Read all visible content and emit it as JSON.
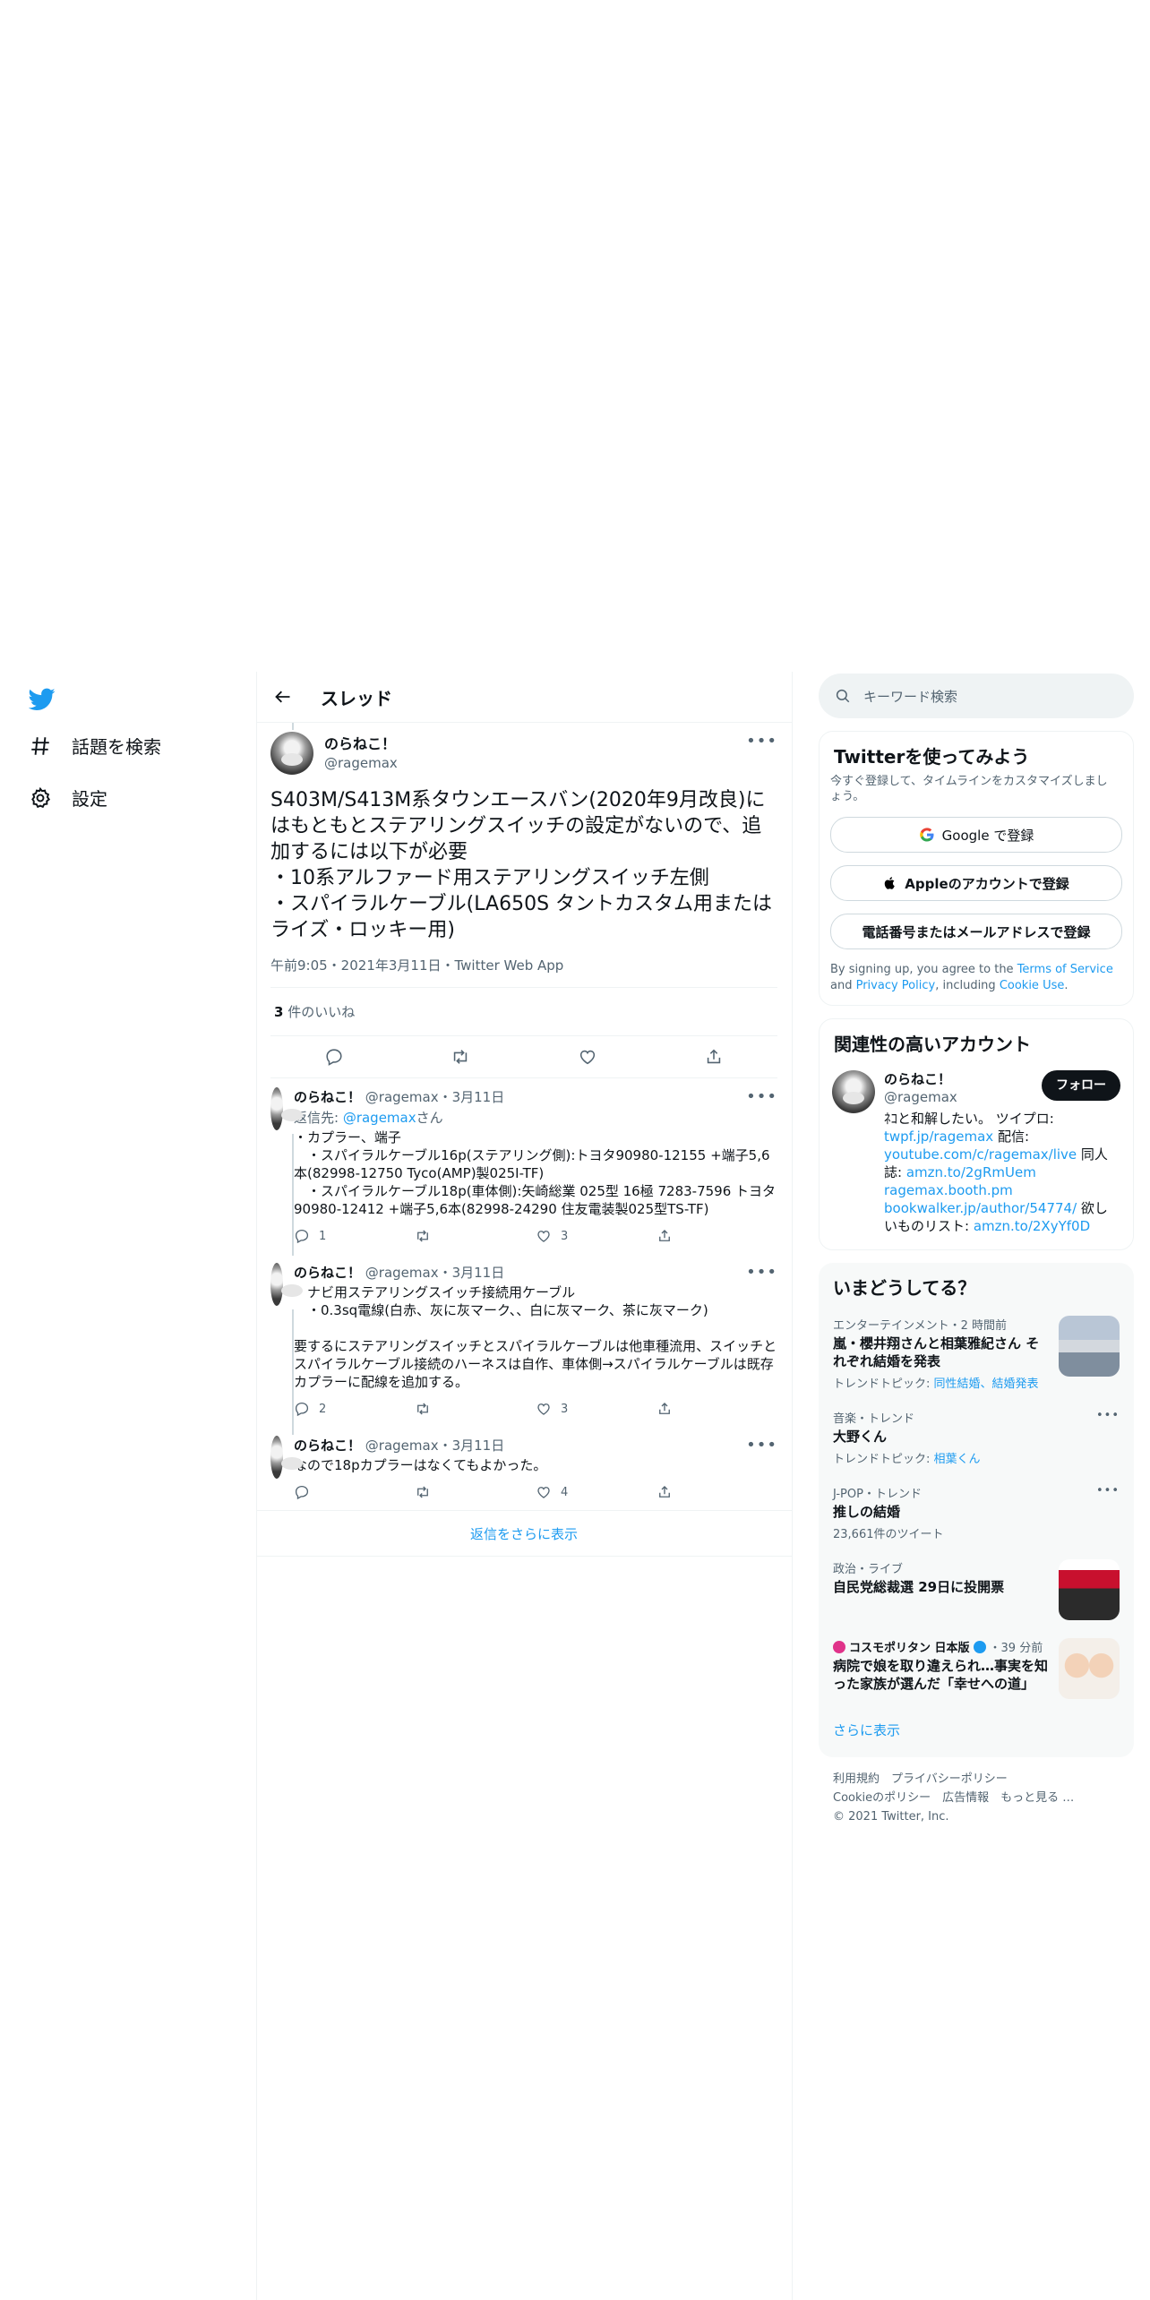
{
  "nav": {
    "items": [
      {
        "label": "話題を検索",
        "icon": "hashtag-icon"
      },
      {
        "label": "設定",
        "icon": "gear-icon"
      }
    ]
  },
  "header": {
    "title": "スレッド"
  },
  "focus_tweet": {
    "name": "のらねこ！",
    "handle": "@ragemax",
    "text": "S403M/S413M系タウンエースバン(2020年9月改良)にはもともとステアリングスイッチの設定がないので、追加するには以下が必要\n・10系アルファード用ステアリングスイッチ左側\n・スパイラルケーブル(LA650S タントカスタム用またはライズ・ロッキー用)",
    "meta": "午前9:05・2021年3月11日・Twitter Web App",
    "likes_count": "3",
    "likes_label": "件のいいね"
  },
  "replies": [
    {
      "name": "のらねこ！",
      "handle": "@ragemax",
      "date": "・3月11日",
      "reply_to_prefix": "返信先: ",
      "reply_to": "@ragemax",
      "reply_to_suffix": "さん",
      "text": "・カプラー、端子\n　・スパイラルケーブル16p(ステアリング側):トヨタ90980-12155 +端子5,6本(82998-12750 Tyco(AMP)製025I-TF)\n　・スパイラルケーブル18p(車体側):矢崎総業 025型 16極 7283-7596 トヨタ90980-12412 +端子5,6本(82998-24290 住友電装製025型TS-TF)",
      "replies": "1",
      "retweets": "",
      "likes": "3"
    },
    {
      "name": "のらねこ！",
      "handle": "@ragemax",
      "date": "・3月11日",
      "text": "・ナビ用ステアリングスイッチ接続用ケーブル\n　・0.3sq電線(白赤、灰に灰マーク、、白に灰マーク、茶に灰マーク)\n\n要するにステアリングスイッチとスパイラルケーブルは他車種流用、スイッチとスパイラルケーブル接続のハーネスは自作、車体側→スパイラルケーブルは既存カプラーに配線を追加する。",
      "replies": "2",
      "retweets": "",
      "likes": "3"
    },
    {
      "name": "のらねこ！",
      "handle": "@ragemax",
      "date": "・3月11日",
      "text": "なので18pカプラーはなくてもよかった。",
      "replies": "",
      "retweets": "",
      "likes": "4"
    }
  ],
  "show_more_replies": "返信をさらに表示",
  "search": {
    "placeholder": "キーワード検索"
  },
  "signup": {
    "title": "Twitterを使ってみよう",
    "subtitle": "今すぐ登録して、タイムラインをカスタマイズしましょう。",
    "google": "Google で登録",
    "apple": "Appleのアカウントで登録",
    "phone": "電話番号またはメールアドレスで登録",
    "tos_1": "By signing up, you agree to the ",
    "tos_terms": "Terms of Service",
    "tos_2": " and ",
    "tos_privacy": "Privacy Policy",
    "tos_3": ", including ",
    "tos_cookie": "Cookie Use",
    "tos_4": "."
  },
  "related": {
    "title": "関連性の高いアカウント",
    "name": "のらねこ！",
    "handle": "@ragemax",
    "follow": "フォロー",
    "bio_1": "ﾈｺと和解したい。 ツイプロ: ",
    "link_1": "twpf.jp/ragemax",
    "bio_2": " 配信: ",
    "link_2": "youtube.com/c/ragemax/live",
    "bio_3": " 同人誌: ",
    "link_3": "amzn.to/2gRmUem",
    "link_4": "ragemax.booth.pm",
    "link_5": "bookwalker.jp/author/54774/",
    "bio_4": " 欲しいものリスト: ",
    "link_6": "amzn.to/2XyYf0D"
  },
  "trends": {
    "title": "いまどうしてる？",
    "items": [
      {
        "category": "エンターテインメント・2 時間前",
        "name": "嵐・櫻井翔さんと相葉雅紀さん それぞれ結婚を発表",
        "sub_prefix": "トレンドトピック: ",
        "sub_links": "同性結婚、結婚発表"
      },
      {
        "category": "音楽・トレンド",
        "name": "大野くん",
        "sub_prefix": "トレンドトピック: ",
        "sub_links": "相葉くん"
      },
      {
        "category": "J-POP・トレンド",
        "name": "推しの結婚",
        "sub_prefix": "23,661件のツイート",
        "sub_links": ""
      },
      {
        "category": "政治・ライブ",
        "name": "自民党総裁選 29日に投開票",
        "sub_prefix": "",
        "sub_links": ""
      },
      {
        "category": "コスモポリタン 日本版",
        "time": "・39 分前",
        "name": "病院で娘を取り違えられ…事実を知った家族が選んだ「幸せへの道」",
        "sub_prefix": "",
        "sub_links": ""
      }
    ],
    "show_more": "さらに表示"
  },
  "footer": {
    "line1": "利用規約　プライバシーポリシー",
    "line2": "Cookieのポリシー　広告情報　もっと見る …",
    "line3": "© 2021 Twitter, Inc."
  },
  "colors": {
    "accent": "#1d9bf0",
    "text": "#0f1419",
    "muted": "#536471"
  }
}
